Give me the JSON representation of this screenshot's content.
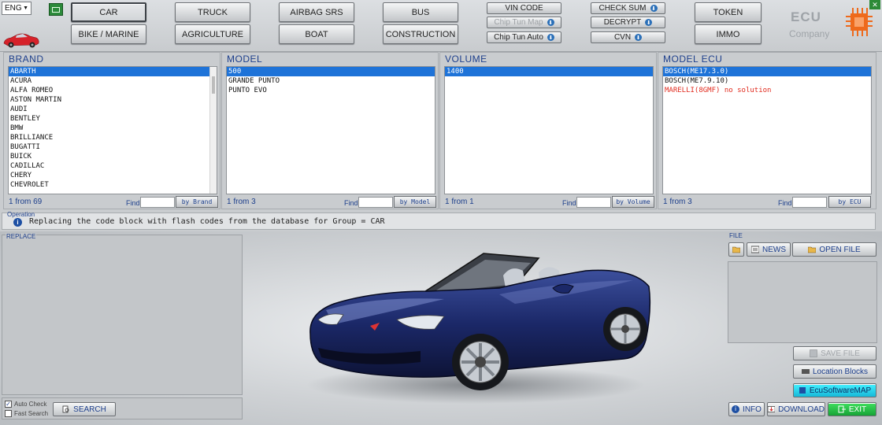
{
  "lang": "ENG",
  "categories_row1": [
    "CAR",
    "TRUCK",
    "AIRBAG SRS",
    "BUS"
  ],
  "categories_row2": [
    "BIKE / MARINE",
    "AGRICULTURE",
    "BOAT",
    "CONSTRUCTION"
  ],
  "active_category": "CAR",
  "tools_col1": [
    "VIN CODE",
    "Chip Tun Map",
    "Chip Tun Auto"
  ],
  "tools_col2": [
    "CHECK SUM",
    "DECRYPT",
    "CVN"
  ],
  "tools_col3": [
    "TOKEN",
    "IMMO"
  ],
  "logo": {
    "line1": "ECU",
    "line2": "Company"
  },
  "brand_panel": {
    "title": "BRAND",
    "items": [
      "ABARTH",
      "ACURA",
      "ALFA ROMEO",
      "ASTON MARTIN",
      "AUDI",
      "BENTLEY",
      "BMW",
      "BRILLIANCE",
      "BUGATTI",
      "BUICK",
      "CADILLAC",
      "CHERY",
      "CHEVROLET"
    ],
    "selected": 0,
    "count": "1 from 69",
    "find_label": "Find",
    "by_label": "by Brand"
  },
  "model_panel": {
    "title": "MODEL",
    "items": [
      "500",
      "GRANDE PUNTO",
      "PUNTO EVO"
    ],
    "selected": 0,
    "count": "1 from 3",
    "find_label": "Find",
    "by_label": "by Model"
  },
  "volume_panel": {
    "title": "VOLUME",
    "items": [
      "1400"
    ],
    "selected": 0,
    "count": "1 from 1",
    "find_label": "Find",
    "by_label": "by Volume"
  },
  "ecu_panel": {
    "title": "MODEL ECU",
    "items": [
      "BOSCH(ME17.3.0)",
      "BOSCH(ME7.9.10)",
      "MARELLI(8GMF)   no solution"
    ],
    "selected": 0,
    "red_index": 2,
    "count": "1 from 3",
    "find_label": "Find",
    "by_label": "by ECU"
  },
  "operation": {
    "label": "Operation",
    "text": "Replacing the code block with flash codes from the database for Group = CAR"
  },
  "replace_label": "REPLACE",
  "options": {
    "auto_check": "Auto Check",
    "fast_search": "Fast Search",
    "search_btn": "SEARCH"
  },
  "file_panel": {
    "label": "FILE",
    "news": "NEWS",
    "open_file": "OPEN FILE",
    "save_file": "SAVE FILE",
    "location_blocks": "Location Blocks",
    "ecu_map": "EcuSoftwareMAP",
    "info": "INFO",
    "download": "DOWNLOAD",
    "exit": "EXIT"
  },
  "colors": {
    "accent": "#1d3f8c",
    "selection": "#1e73d8",
    "alert": "#e12b1e",
    "car_body": "#1a2a66",
    "exit": "#17a236",
    "map": "#16b8d8"
  }
}
